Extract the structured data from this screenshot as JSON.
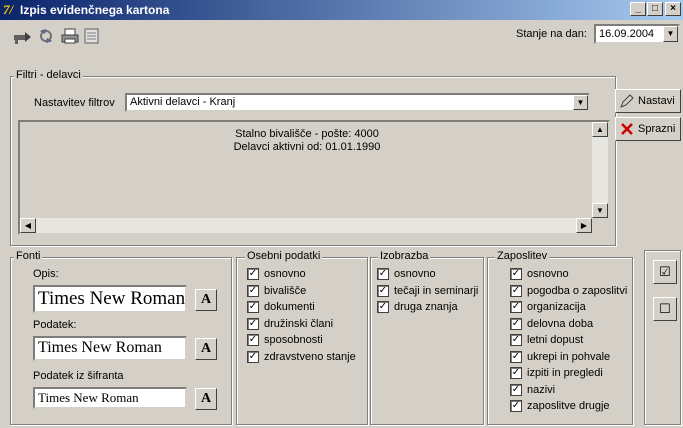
{
  "window": {
    "title": "Izpis evidenčnega kartona",
    "app_icon": "7/",
    "min_glyph": "_",
    "max_glyph": "□",
    "close_glyph": "×"
  },
  "toolbar": {
    "icons": [
      "export-icon",
      "refresh-icon",
      "print-icon",
      "preview-icon"
    ],
    "date_label": "Stanje na dan:",
    "date_value": "16.09.2004"
  },
  "filters": {
    "group_label": "Filtri - delavci",
    "setting_label": "Nastavitev filtrov",
    "setting_value": "Aktivni delavci - Kranj",
    "set_button": "Nastavi",
    "clear_button": "Sprazni",
    "info_lines": [
      "Stalno bivališče - pošte: 4000",
      "Delavci aktivni od: 01.01.1990"
    ]
  },
  "fonts": {
    "group_label": "Fonti",
    "opis_label": "Opis:",
    "opis_value": "Times New Roman",
    "podatek_label": "Podatek:",
    "podatek_value": "Times New Roman",
    "sifrant_label": "Podatek iz šifranta",
    "sifrant_value": "Times New Roman",
    "font_button": "A"
  },
  "osebni": {
    "group_label": "Osebni podatki",
    "items": [
      "osnovno",
      "bivališče",
      "dokumenti",
      "družinski člani",
      "sposobnosti",
      "zdravstveno stanje"
    ]
  },
  "izobrazba": {
    "group_label": "Izobrazba",
    "items": [
      "osnovno",
      "tečaji in seminarji",
      "druga znanja"
    ]
  },
  "zaposlitev": {
    "group_label": "Zaposlitev",
    "items": [
      "osnovno",
      "pogodba o zaposlitvi",
      "organizacija",
      "delovna doba",
      "letni dopust",
      "ukrepi in pohvale",
      "izpiti in pregledi",
      "nazivi",
      "zaposlitve drugje"
    ]
  },
  "check_mark": "✓",
  "side_buttons": {
    "check_all": "☑",
    "uncheck_all": "☐"
  },
  "colors": {
    "title_start": "#0a246a",
    "title_end": "#a6caf0",
    "face": "#d4d0c8",
    "clear_x": "#cc0000"
  }
}
